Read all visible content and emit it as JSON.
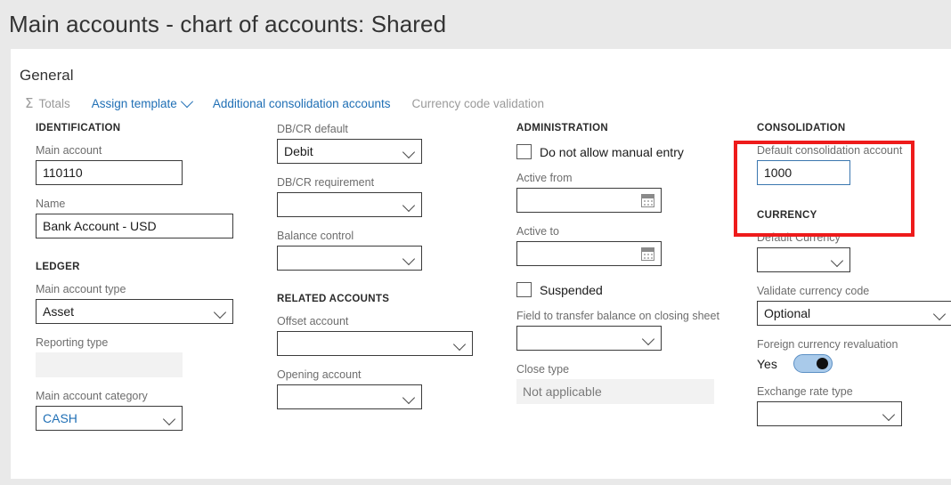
{
  "header": {
    "title": "Main accounts - chart of accounts: Shared"
  },
  "card": {
    "section_title": "General"
  },
  "toolbar": {
    "items": [
      {
        "label": "Totals",
        "icon": "sigma-icon",
        "state": "disabled"
      },
      {
        "label": "Assign template",
        "icon": "chevron-down-icon",
        "state": "link"
      },
      {
        "label": "Additional consolidation accounts",
        "state": "link"
      },
      {
        "label": "Currency code validation",
        "state": "disabled"
      }
    ]
  },
  "identification": {
    "group": "IDENTIFICATION",
    "main_account": {
      "label": "Main account",
      "value": "110110"
    },
    "name": {
      "label": "Name",
      "value": "Bank Account - USD"
    }
  },
  "ledger": {
    "group": "LEDGER",
    "main_account_type": {
      "label": "Main account type",
      "value": "Asset"
    },
    "reporting_type": {
      "label": "Reporting type",
      "value": ""
    },
    "main_account_category": {
      "label": "Main account category",
      "value": "CASH"
    }
  },
  "column2": {
    "dbcr_default": {
      "label": "DB/CR default",
      "value": "Debit"
    },
    "dbcr_requirement": {
      "label": "DB/CR requirement",
      "value": ""
    },
    "balance_control": {
      "label": "Balance control",
      "value": ""
    },
    "related_group": "RELATED ACCOUNTS",
    "offset_account": {
      "label": "Offset account",
      "value": ""
    },
    "opening_account": {
      "label": "Opening account",
      "value": ""
    }
  },
  "administration": {
    "group": "ADMINISTRATION",
    "no_manual_entry": {
      "label": "Do not allow manual entry",
      "checked": false
    },
    "active_from": {
      "label": "Active from",
      "value": ""
    },
    "active_to": {
      "label": "Active to",
      "value": ""
    },
    "suspended": {
      "label": "Suspended",
      "checked": false
    },
    "transfer_field": {
      "label": "Field to transfer balance on closing sheet",
      "value": ""
    },
    "close_type": {
      "label": "Close type",
      "value": "Not applicable"
    }
  },
  "consolidation": {
    "group": "CONSOLIDATION",
    "default_consolidation_account": {
      "label": "Default consolidation account",
      "value": "1000"
    }
  },
  "currency": {
    "group": "CURRENCY",
    "default_currency": {
      "label": "Default Currency",
      "value": ""
    },
    "validate_currency_code": {
      "label": "Validate currency code",
      "value": "Optional"
    },
    "foreign_currency_revaluation": {
      "label": "Foreign currency revaluation",
      "state_text": "Yes",
      "on": true
    },
    "exchange_rate_type": {
      "label": "Exchange rate type",
      "value": ""
    }
  },
  "colors": {
    "page_bg": "#e9e9e9",
    "card_bg": "#ffffff",
    "link": "#1f6fb5",
    "disabled_text": "#9a9a9a",
    "annotation": "#ee1b1b",
    "focus_border": "#3b77af",
    "toggle_track": "#a9caea"
  }
}
